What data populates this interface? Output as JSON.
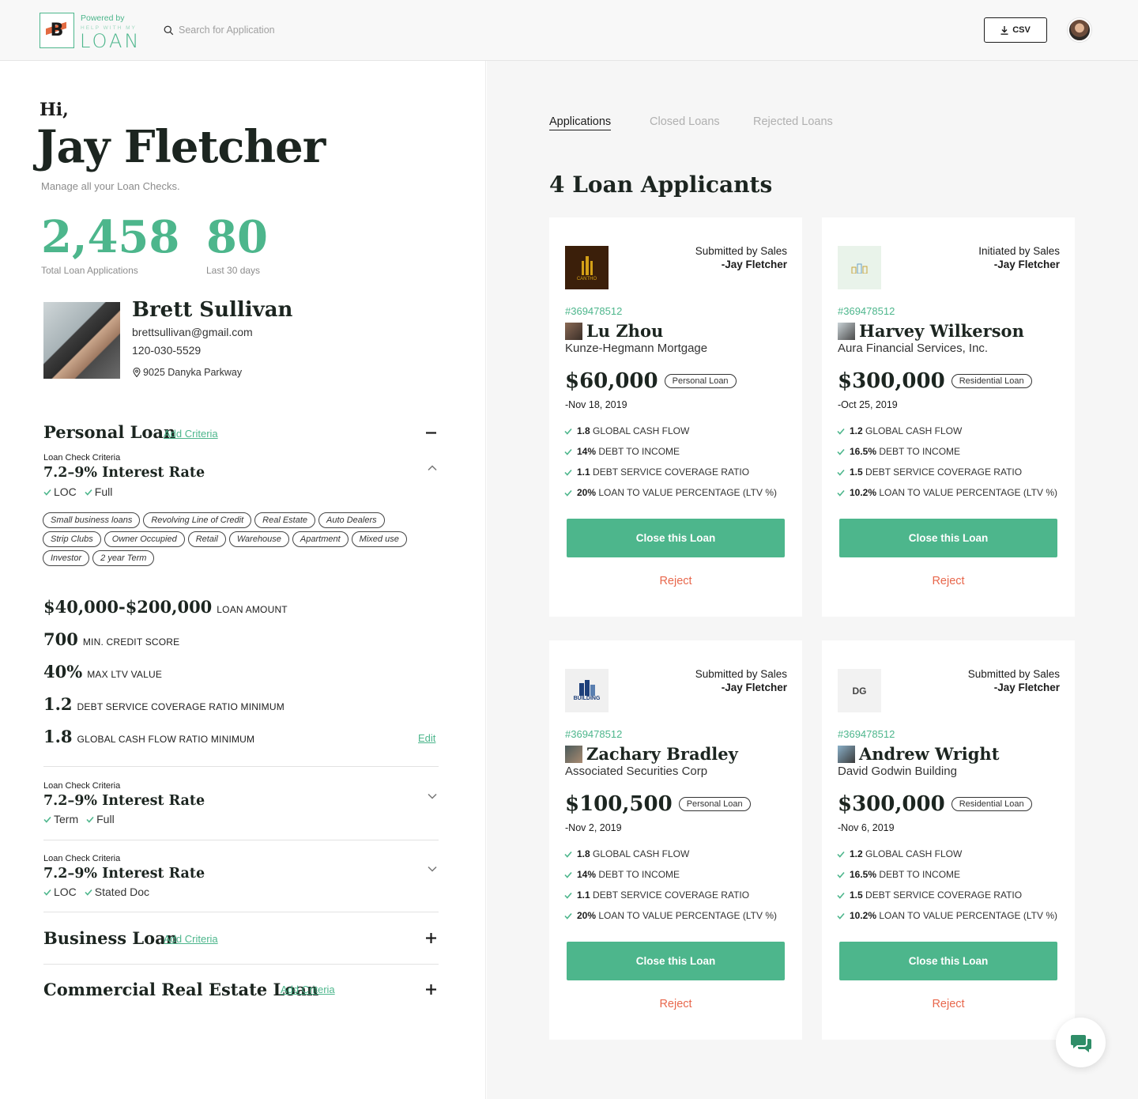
{
  "header": {
    "powered_by": "Powered by",
    "brand_small": "HELP WITH MY",
    "brand_word": "LOAN",
    "search_placeholder": "Search for Application",
    "csv_label": "CSV"
  },
  "greeting": {
    "hi": "Hi,",
    "name": "Jay Fletcher",
    "subtitle": "Manage all your Loan Checks."
  },
  "stats": [
    {
      "value": "2,458",
      "label": "Total Loan Applications"
    },
    {
      "value": "80",
      "label": "Last 30 days"
    }
  ],
  "profile": {
    "name": "Brett Sullivan",
    "email": "brettsullivan@gmail.com",
    "phone": "120-030-5529",
    "address": "9025 Danyka Parkway"
  },
  "personal_loan": {
    "title": "Personal Loan",
    "add_criteria": "Add Criteria",
    "criteria": [
      {
        "label": "Loan Check Criteria",
        "rate": "7.2–9%  Interest Rate",
        "checks": [
          "LOC",
          "Full"
        ]
      },
      {
        "label": "Loan Check Criteria",
        "rate": "7.2–9%  Interest Rate",
        "checks": [
          "Term",
          "Full"
        ]
      },
      {
        "label": "Loan Check Criteria",
        "rate": "7.2–9%  Interest Rate",
        "checks": [
          "LOC",
          "Stated Doc"
        ]
      }
    ],
    "tags": [
      "Small business loans",
      "Revolving Line of Credit",
      "Real Estate",
      "Auto Dealers",
      "Strip Clubs",
      "Owner Occupied",
      "Retail",
      "Warehouse",
      "Apartment",
      "Mixed use",
      "Investor",
      "2 year Term"
    ],
    "metrics": [
      {
        "value": "$40,000-$200,000",
        "label": "LOAN AMOUNT"
      },
      {
        "value": "700",
        "label": "MIN. CREDIT SCORE"
      },
      {
        "value": "40%",
        "label": "MAX LTV VALUE"
      },
      {
        "value": "1.2",
        "label": "DEBT SERVICE COVERAGE RATIO MINIMUM"
      },
      {
        "value": "1.8",
        "label": "GLOBAL CASH FLOW RATIO MINIMUM"
      }
    ],
    "edit_label": "Edit"
  },
  "business_loan": {
    "title": "Business Loan",
    "add_criteria": "Add Criteria"
  },
  "commercial_loan": {
    "title": "Commercial Real Estate Loan",
    "add_criteria": "Add Criteria"
  },
  "tabs": [
    "Applications",
    "Closed Loans",
    "Rejected Loans"
  ],
  "applicants_title": "4 Loan Applicants",
  "cards": [
    {
      "submitted": "Submitted by Sales",
      "by": "-Jay Fletcher",
      "logo_text": "CANTHO",
      "id": "#369478512",
      "name": "Lu Zhou",
      "company": "Kunze-Hegmann Mortgage",
      "amount": "$60,000",
      "loan_type": "Personal Loan",
      "date": "-Nov 18, 2019",
      "metrics": [
        {
          "value": "1.8",
          "label": "GLOBAL CASH FLOW"
        },
        {
          "value": "14%",
          "label": "DEBT TO INCOME"
        },
        {
          "value": "1.1",
          "label": "DEBT SERVICE COVERAGE RATIO"
        },
        {
          "value": "20%",
          "label": "LOAN TO VALUE PERCENTAGE (LTV %)"
        }
      ],
      "close_label": "Close this Loan",
      "reject_label": "Reject"
    },
    {
      "submitted": "Initiated by Sales",
      "by": "-Jay Fletcher",
      "logo_text": "",
      "id": "#369478512",
      "name": "Harvey Wilkerson",
      "company": "Aura Financial Services, Inc.",
      "amount": "$300,000",
      "loan_type": "Residential Loan",
      "date": "-Oct 25, 2019",
      "metrics": [
        {
          "value": "1.2",
          "label": "GLOBAL CASH FLOW"
        },
        {
          "value": "16.5%",
          "label": "DEBT TO INCOME"
        },
        {
          "value": "1.5",
          "label": "DEBT SERVICE COVERAGE RATIO"
        },
        {
          "value": "10.2%",
          "label": "LOAN TO VALUE PERCENTAGE (LTV %)"
        }
      ],
      "close_label": "Close this Loan",
      "reject_label": "Reject"
    },
    {
      "submitted": "Submitted by Sales",
      "by": "-Jay Fletcher",
      "logo_text": "BUILDING",
      "id": "#369478512",
      "name": "Zachary Bradley",
      "company": "Associated Securities Corp",
      "amount": "$100,500",
      "loan_type": "Personal Loan",
      "date": "-Nov 2, 2019",
      "metrics": [
        {
          "value": "1.8",
          "label": "GLOBAL CASH FLOW"
        },
        {
          "value": "14%",
          "label": "DEBT TO INCOME"
        },
        {
          "value": "1.1",
          "label": "DEBT SERVICE COVERAGE RATIO"
        },
        {
          "value": "20%",
          "label": "LOAN TO VALUE PERCENTAGE (LTV %)"
        }
      ],
      "close_label": "Close this Loan",
      "reject_label": "Reject"
    },
    {
      "submitted": "Submitted by Sales",
      "by": "-Jay Fletcher",
      "logo_text": "DG",
      "id": "#369478512",
      "name": "Andrew Wright",
      "company": "David Godwin Building",
      "amount": "$300,000",
      "loan_type": "Residential Loan",
      "date": "-Nov 6, 2019",
      "metrics": [
        {
          "value": "1.2",
          "label": "GLOBAL CASH FLOW"
        },
        {
          "value": "16.5%",
          "label": "DEBT TO INCOME"
        },
        {
          "value": "1.5",
          "label": "DEBT SERVICE COVERAGE RATIO"
        },
        {
          "value": "10.2%",
          "label": "LOAN TO VALUE PERCENTAGE (LTV %)"
        }
      ],
      "close_label": "Close this Loan",
      "reject_label": "Reject"
    }
  ],
  "colors": {
    "accent": "#4db68c",
    "reject": "#e8674c",
    "text": "#1c2520"
  },
  "icons": [
    "search-icon",
    "download-icon",
    "location-pin-icon",
    "check-icon",
    "minus-icon",
    "plus-icon",
    "chevron-up-icon",
    "chevron-down-icon",
    "chat-icon"
  ]
}
